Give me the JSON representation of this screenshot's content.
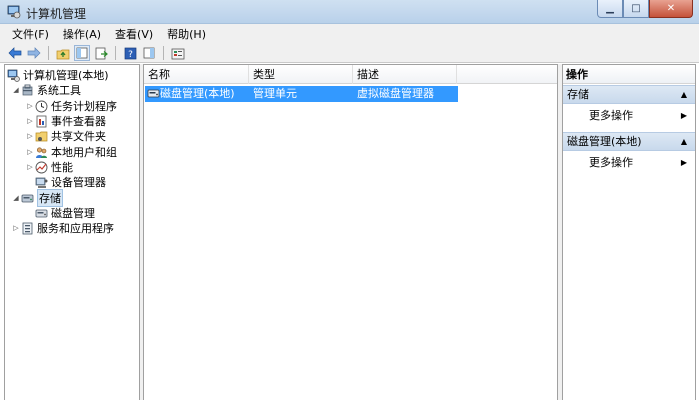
{
  "window": {
    "title": "计算机管理",
    "min_glyph": "▁",
    "max_glyph": "□",
    "close_glyph": "✕"
  },
  "menu": [
    "文件(F)",
    "操作(A)",
    "查看(V)",
    "帮助(H)"
  ],
  "toolbar": {
    "icons": [
      "back-arrow-icon",
      "forward-arrow-icon",
      "up-folder-icon",
      "show-hide-tree-icon",
      "export-list-icon",
      "help-icon",
      "show-hide-action-pane-icon",
      "properties-icon"
    ]
  },
  "tree": {
    "root": "计算机管理(本地)",
    "system_tools": "系统工具",
    "task_scheduler": "任务计划程序",
    "event_viewer": "事件查看器",
    "shared_folders": "共享文件夹",
    "local_users": "本地用户和组",
    "performance": "性能",
    "device_manager": "设备管理器",
    "storage": "存储",
    "disk_management": "磁盘管理",
    "services_apps": "服务和应用程序"
  },
  "list": {
    "columns": [
      "名称",
      "类型",
      "描述"
    ],
    "rows": [
      {
        "name": "磁盘管理(本地)",
        "type": "管理单元",
        "desc": "虚拟磁盘管理器"
      }
    ]
  },
  "actions": {
    "header": "操作",
    "sections": [
      {
        "title": "存储",
        "item": "更多操作"
      },
      {
        "title": "磁盘管理(本地)",
        "item": "更多操作"
      }
    ]
  },
  "colors": {
    "selection": "#3399ff",
    "title_bar": "#cfe0f1",
    "close_button": "#c5523a"
  }
}
